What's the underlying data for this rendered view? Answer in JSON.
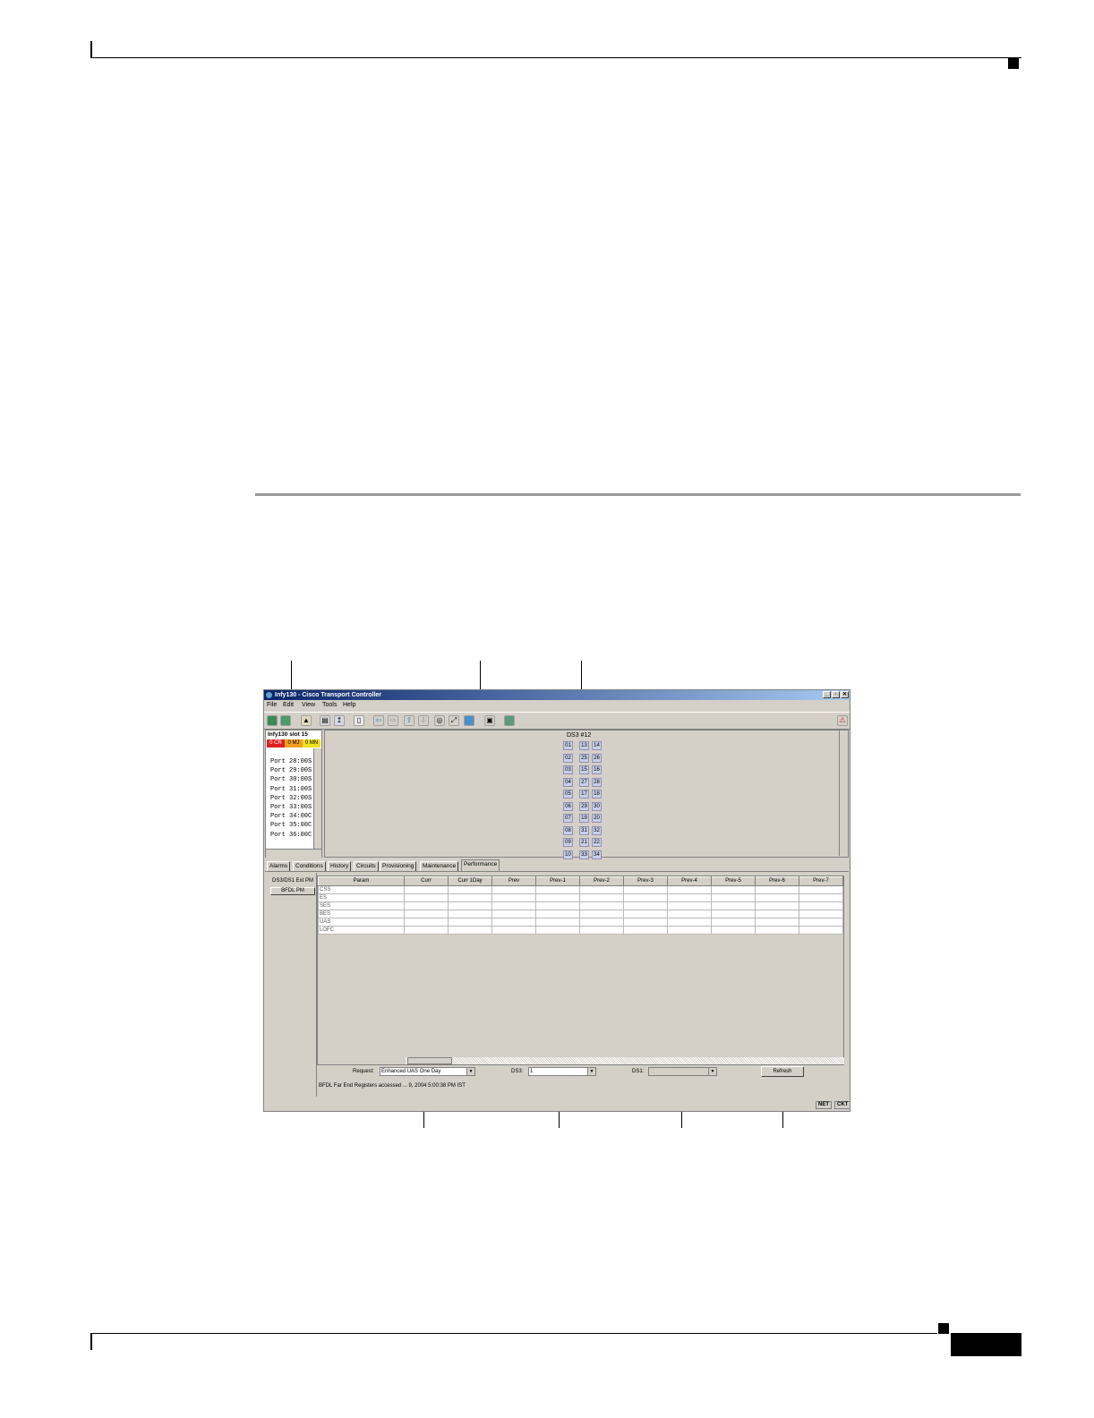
{
  "window": {
    "title": "Infy130 - Cisco Transport Controller",
    "menu": [
      "File",
      "Edit",
      "View",
      "Tools",
      "Help"
    ]
  },
  "alarms": {
    "node": "Infy130",
    "slot": "slot 15",
    "cr": "0 CR",
    "mj": "0 MJ",
    "mn": "0 MN"
  },
  "ports": [
    "Port 28:00S",
    "Port 29:00S",
    "Port 30:00S",
    "Port 31:00S",
    "Port 32:00S",
    "Port 33:00S",
    "Port 34:00C",
    "Port 35:00C",
    "Port 36:00C"
  ],
  "shelf": {
    "label": "DS3 #12",
    "col1": [
      "01",
      "02",
      "03",
      "04",
      "05",
      "06",
      "07",
      "08",
      "09",
      "10"
    ],
    "col2": [
      "13",
      "25",
      "15",
      "27",
      "17",
      "29",
      "19",
      "31",
      "21",
      "33"
    ],
    "col3": [
      "14",
      "26",
      "16",
      "28",
      "18",
      "30",
      "20",
      "32",
      "22",
      "34"
    ]
  },
  "tabs": [
    "Alarms",
    "Conditions",
    "History",
    "Circuits",
    "Provisioning",
    "Maintenance",
    "Performance"
  ],
  "side_buttons": [
    "DS3/DS1 Ext PM",
    "BFDL PM"
  ],
  "table": {
    "headers": [
      "Param",
      "Curr",
      "Curr 1Day",
      "Prev",
      "Prev-1",
      "Prev-2",
      "Prev-3",
      "Prev-4",
      "Prev-5",
      "Prev-6",
      "Prev-7"
    ],
    "rows": [
      "CSS",
      "ES",
      "SES",
      "BES",
      "UAS",
      "LOFC"
    ]
  },
  "controls": {
    "request_label": "Request:",
    "request_value": "Enhanced UAS One Day",
    "ds3_label": "DS3:",
    "ds3_value": "1",
    "ds1_label": "DS1:",
    "ds1_value": "",
    "refresh_label": "Refresh",
    "status_text": "BFDL Far End Registers accessed ... 9, 2004 5:00:38 PM IST"
  },
  "statusbar": {
    "net": "NET",
    "ckt": "CKT"
  }
}
